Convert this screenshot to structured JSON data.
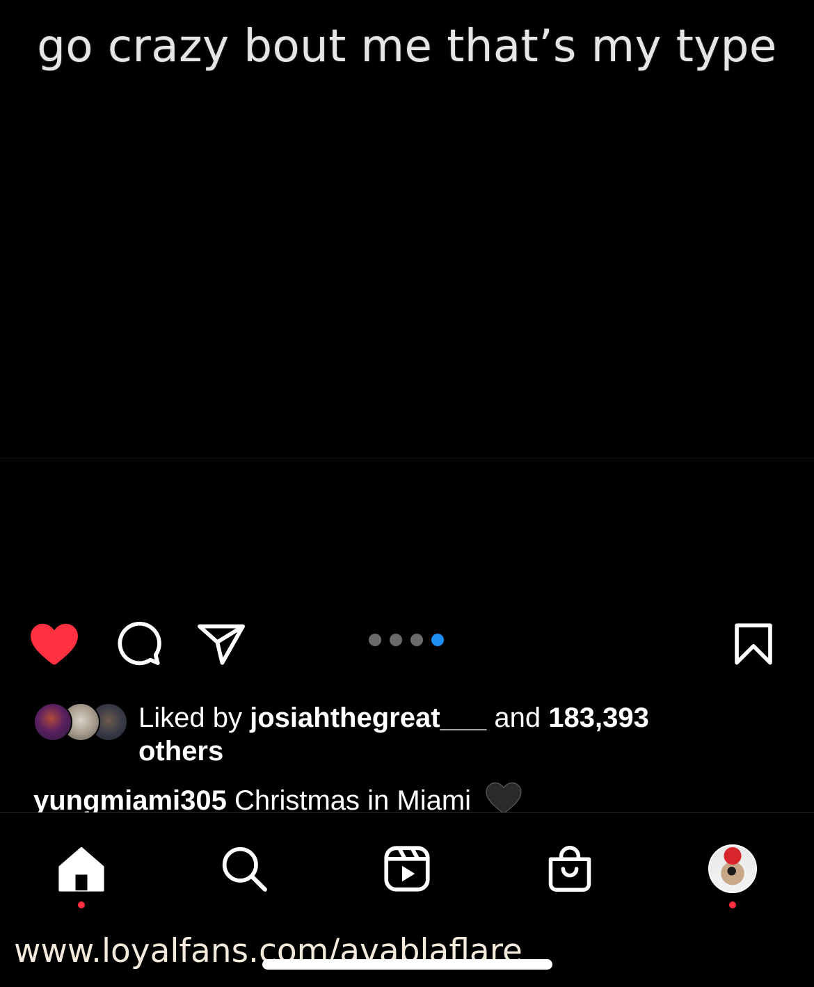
{
  "post": {
    "image_text": "go crazy bout me that’s my type",
    "carousel": {
      "count": 4,
      "active_index": 4
    }
  },
  "actions": {
    "liked": true,
    "like_icon": "heart-filled-icon",
    "comment_icon": "comment-bubble-icon",
    "share_icon": "paper-plane-icon",
    "save_icon": "bookmark-icon"
  },
  "likes": {
    "prefix": "Liked by ",
    "user": "josiahthegreat___",
    "middle": " and ",
    "count": "183,393",
    "suffix": "others"
  },
  "caption": {
    "username": "yungmiami305",
    "text": "Christmas in Miami"
  },
  "bottom_nav": {
    "items": [
      "home-icon",
      "search-icon",
      "reels-icon",
      "shop-icon",
      "profile-avatar"
    ],
    "notification_dots": [
      "home",
      "profile"
    ]
  },
  "watermark": "www.loyalfans.com/avablaflare",
  "colors": {
    "background": "#000000",
    "like_red": "#ff3040",
    "active_dot": "#1f8ff5",
    "inactive_dot": "#6b6b6b"
  }
}
